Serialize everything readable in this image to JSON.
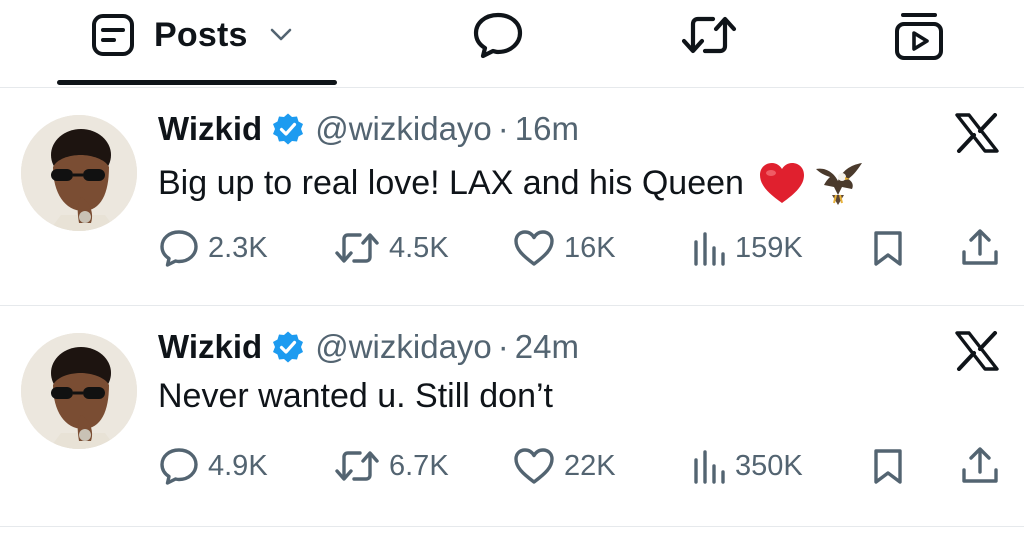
{
  "tabs": {
    "posts_label": "Posts",
    "posts_icon": "posts-icon",
    "replies_icon": "reply-icon",
    "reposts_icon": "repost-icon",
    "media_icon": "media-icon"
  },
  "colors": {
    "text": "#0f1419",
    "muted": "#536471",
    "verified": "#1d9bf0",
    "divider": "#e6e9ec",
    "heart": "#e0202e"
  },
  "tweets": [
    {
      "name": "Wizkid",
      "handle": "@wizkidayo",
      "separator": "·",
      "time": "16m",
      "text": "Big up to real love!  LAX and his Queen",
      "emojis": [
        "red-heart-emoji",
        "eagle-emoji"
      ],
      "replies": "2.3K",
      "reposts": "4.5K",
      "likes": "16K",
      "views": "159K"
    },
    {
      "name": "Wizkid",
      "handle": "@wizkidayo",
      "separator": "·",
      "time": "24m",
      "text": "Never wanted u. Still don’t",
      "emojis": [],
      "replies": "4.9K",
      "reposts": "6.7K",
      "likes": "22K",
      "views": "350K"
    }
  ]
}
